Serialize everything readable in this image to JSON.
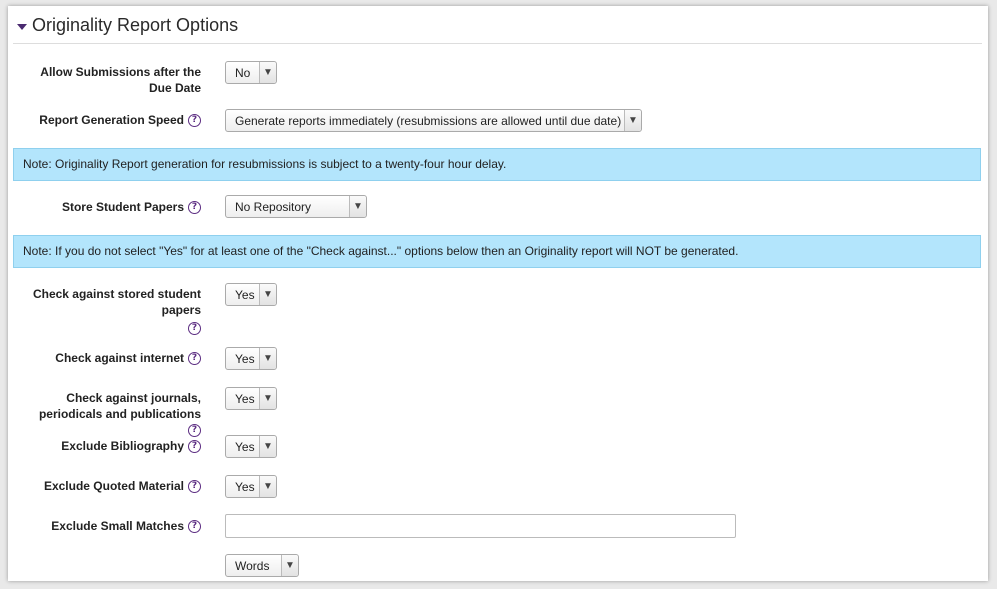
{
  "section": {
    "title": "Originality Report Options"
  },
  "fields": {
    "allow_late": {
      "label": "Allow Submissions after the Due Date",
      "value": "No"
    },
    "gen_speed": {
      "label": "Report Generation Speed",
      "value": "Generate reports immediately (resubmissions are allowed until due date)"
    },
    "store_papers": {
      "label": "Store Student Papers",
      "value": "No Repository"
    },
    "check_stored": {
      "label": "Check against stored student papers",
      "value": "Yes"
    },
    "check_internet": {
      "label": "Check against internet",
      "value": "Yes"
    },
    "check_journals": {
      "label": "Check against journals, periodicals and publications",
      "value": "Yes"
    },
    "exclude_bib": {
      "label": "Exclude Bibliography",
      "value": "Yes"
    },
    "exclude_quoted": {
      "label": "Exclude Quoted Material",
      "value": "Yes"
    },
    "exclude_small": {
      "label": "Exclude Small Matches",
      "value": "",
      "unit": "Words"
    }
  },
  "notes": {
    "resubmission": "Note: Originality Report generation for resubmissions is subject to a twenty-four hour delay.",
    "check_against": "Note: If you do not select \"Yes\" for at least one of the \"Check against...\" options below then an Originality report will NOT be generated."
  },
  "icons": {
    "help": "help-icon",
    "collapse": "collapse-triangle-icon",
    "dropdown": "chevron-down-icon"
  },
  "colors": {
    "accent": "#5c2d82",
    "note_bg": "#b3e5fc"
  }
}
